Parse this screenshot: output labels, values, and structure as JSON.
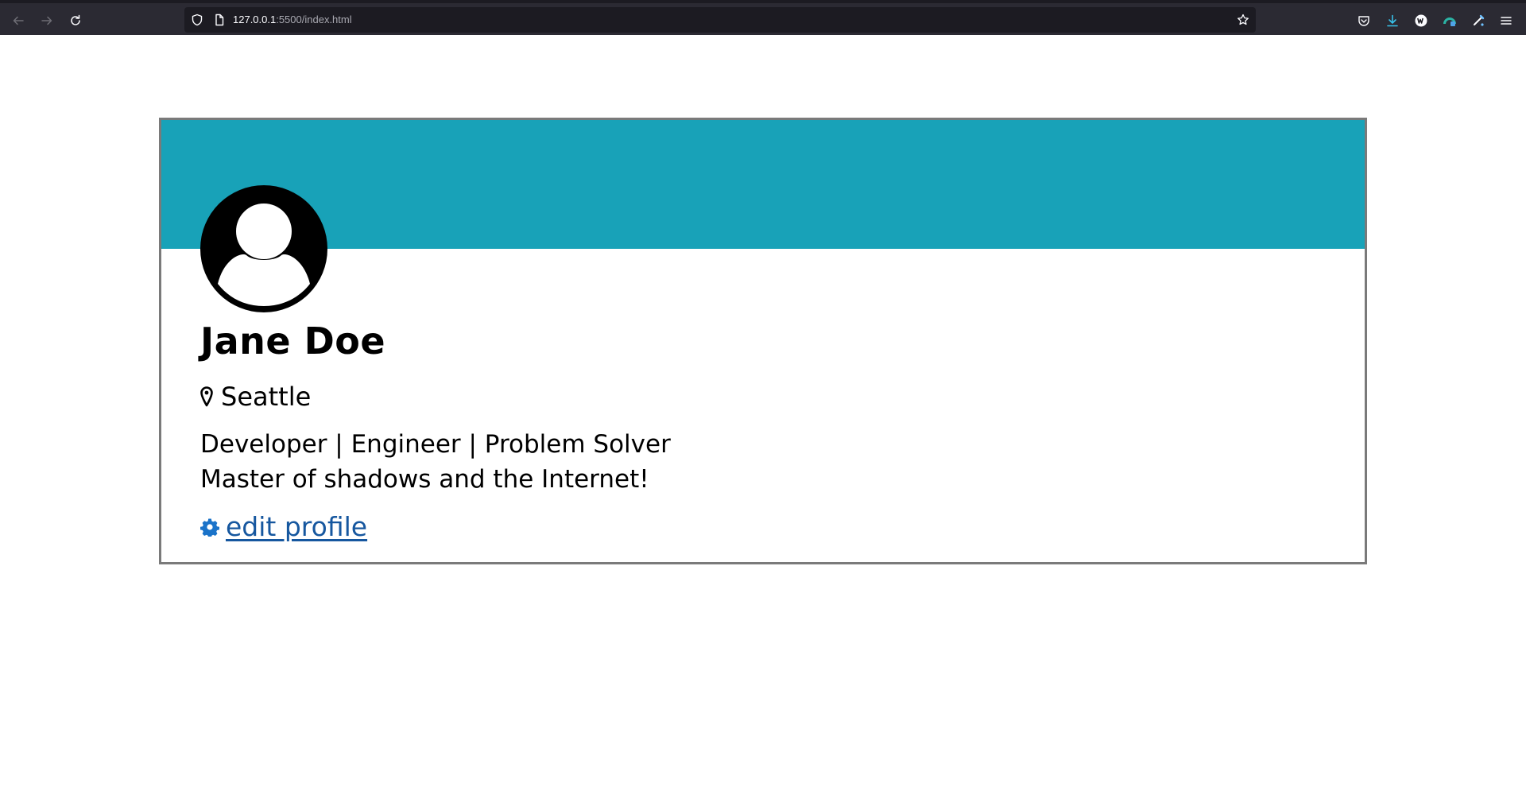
{
  "browser": {
    "url_host": "127.0.0.1",
    "url_path": ":5500/index.html"
  },
  "profile": {
    "name": "Jane Doe",
    "location": "Seattle",
    "bio_line1": "Developer | Engineer | Problem Solver",
    "bio_line2": "Master of shadows and the Internet!",
    "edit_label": "edit profile"
  },
  "colors": {
    "banner": "#18a2b8",
    "link": "#16579f",
    "gear": "#1a73c9"
  }
}
